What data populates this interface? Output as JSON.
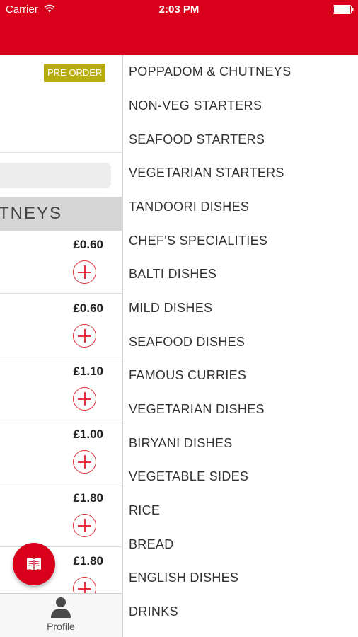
{
  "status_bar": {
    "carrier": "Carrier",
    "time": "2:03 PM",
    "wifi_icon": "wifi-icon",
    "battery_icon": "battery-icon"
  },
  "left_panel": {
    "badge": "PRE ORDER",
    "category_header": "TNEYS",
    "items": [
      {
        "price": "£0.60"
      },
      {
        "price": "£0.60"
      },
      {
        "price": "£1.10"
      },
      {
        "price": "£1.00"
      },
      {
        "price": "£1.80"
      },
      {
        "price": "£1.80"
      }
    ],
    "fab_icon": "menu-book-icon"
  },
  "tab_bar": {
    "profile_label": "Profile",
    "profile_icon": "person-icon"
  },
  "categories": [
    "POPPADOM & CHUTNEYS",
    "NON-VEG STARTERS",
    "SEAFOOD STARTERS",
    "VEGETARIAN STARTERS",
    "TANDOORI DISHES",
    "CHEF'S SPECIALITIES",
    "BALTI DISHES",
    "MILD DISHES",
    "SEAFOOD DISHES",
    "FAMOUS CURRIES",
    "VEGETARIAN DISHES",
    "BIRYANI DISHES",
    "VEGETABLE SIDES",
    "RICE",
    "BREAD",
    "ENGLISH DISHES",
    "DRINKS"
  ],
  "colors": {
    "brand_red": "#d9001b",
    "badge_olive": "#b7ac14",
    "add_red": "#e0303b"
  }
}
